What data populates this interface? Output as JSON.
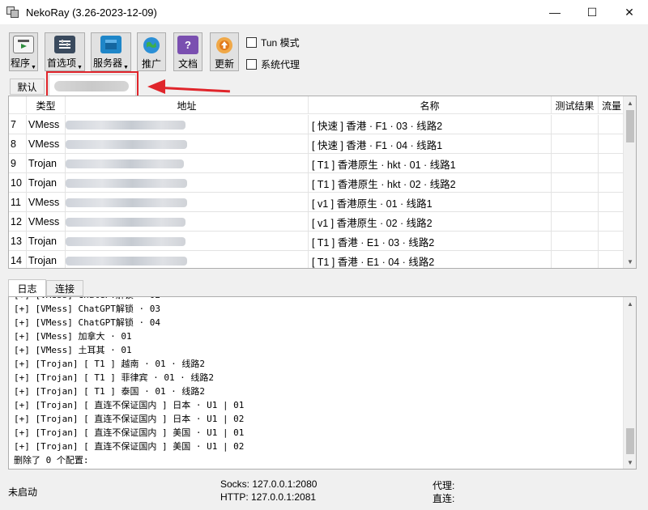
{
  "window": {
    "title": "NekoRay (3.26-2023-12-09)",
    "min_glyph": "—",
    "max_glyph": "☐",
    "close_glyph": "✕"
  },
  "toolbar": {
    "buttons": [
      {
        "label": "程序",
        "icon": "program-icon",
        "color": "#2c8c3c"
      },
      {
        "label": "首选项",
        "icon": "preferences-icon",
        "color": "#3a4a5e"
      },
      {
        "label": "服务器",
        "icon": "server-icon",
        "color": "#1f86c8"
      },
      {
        "label": "推广",
        "icon": "globe-icon",
        "color": "#2b8fd6"
      },
      {
        "label": "文档",
        "icon": "document-icon",
        "color": "#7a4fb0"
      },
      {
        "label": "更新",
        "icon": "update-icon",
        "color": "#e08a2a"
      }
    ],
    "dropdown_glyph": "▼",
    "tun_label": "Tun 模式",
    "system_proxy_label": "系统代理"
  },
  "groups": {
    "default_tab": "默认"
  },
  "table": {
    "headers": [
      "类型",
      "地址",
      "名称",
      "测试结果",
      "流量"
    ],
    "rows": [
      {
        "num": "7",
        "type": "VMess",
        "name": "[ 快速 ] 香港 · F1 · 03 · 线路2"
      },
      {
        "num": "8",
        "type": "VMess",
        "name": "[ 快速 ] 香港 · F1 · 04 · 线路1"
      },
      {
        "num": "9",
        "type": "Trojan",
        "name": "[ T1 ] 香港原生 · hkt · 01 · 线路1"
      },
      {
        "num": "10",
        "type": "Trojan",
        "name": "[ T1 ] 香港原生 · hkt  · 02 · 线路2"
      },
      {
        "num": "11",
        "type": "VMess",
        "name": "[ v1 ] 香港原生 · 01 · 线路1"
      },
      {
        "num": "12",
        "type": "VMess",
        "name": "[ v1 ] 香港原生 · 02 · 线路2"
      },
      {
        "num": "13",
        "type": "Trojan",
        "name": "[ T1 ] 香港 · E1 · 03 · 线路2"
      },
      {
        "num": "14",
        "type": "Trojan",
        "name": "[ T1 ] 香港 · E1 · 04 · 线路2"
      }
    ],
    "scroll_up": "▲",
    "scroll_down": "▼"
  },
  "log": {
    "tabs": [
      "日志",
      "连接"
    ],
    "lines": [
      "[+] [VMess] ChatGPT解锁 · 03",
      "[+] [VMess] ChatGPT解锁 · 04",
      "[+] [VMess] 加拿大 · 01",
      "[+] [VMess] 土耳其 · 01",
      "[+] [Trojan] [ T1 ] 越南 · 01 · 线路2",
      "[+] [Trojan] [ T1 ] 菲律宾 · 01 · 线路2",
      "[+] [Trojan] [ T1 ] 泰国 · 01 · 线路2",
      "[+] [Trojan] [ 直连不保证国内 ] 日本 · U1 | 01",
      "[+] [Trojan] [ 直连不保证国内 ] 日本 · U1 | 02",
      "[+] [Trojan] [ 直连不保证国内 ] 美国 · U1 | 01",
      "[+] [Trojan] [ 直连不保证国内 ] 美国 · U1 | 02",
      "删除了 0 个配置:"
    ],
    "scroll_up": "▲",
    "scroll_down": "▼"
  },
  "status": {
    "state": "未启动",
    "socks": "Socks: 127.0.0.1:2080",
    "http": "HTTP: 127.0.0.1:2081",
    "proxy": "代理:",
    "direct": "直连:"
  }
}
